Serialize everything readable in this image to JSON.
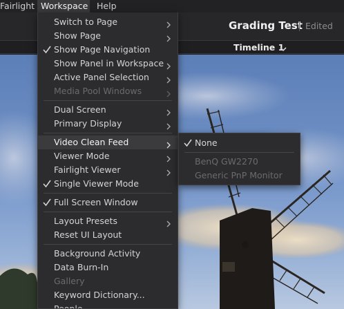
{
  "menubar": {
    "items": [
      {
        "label": "Fairlight"
      },
      {
        "label": "Workspace"
      },
      {
        "label": "Help"
      }
    ]
  },
  "header": {
    "project_title": "Grading Test",
    "project_status": "Edited"
  },
  "timeline": {
    "name": "Timeline 1"
  },
  "workspace_menu": {
    "items": [
      {
        "label": "Switch to Page",
        "submenu": true
      },
      {
        "label": "Show Page",
        "submenu": true
      },
      {
        "label": "Show Page Navigation",
        "checked": true
      },
      {
        "label": "Show Panel in Workspace",
        "submenu": true
      },
      {
        "label": "Active Panel Selection",
        "submenu": true
      },
      {
        "label": "Media Pool Windows",
        "submenu": true,
        "disabled": true
      },
      {
        "label": "Dual Screen",
        "submenu": true
      },
      {
        "label": "Primary Display",
        "submenu": true
      },
      {
        "label": "Video Clean Feed",
        "submenu": true,
        "highlighted": true
      },
      {
        "label": "Viewer Mode",
        "submenu": true
      },
      {
        "label": "Fairlight Viewer",
        "submenu": true
      },
      {
        "label": "Single Viewer Mode",
        "checked": true
      },
      {
        "label": "Full Screen Window",
        "checked": true
      },
      {
        "label": "Layout Presets",
        "submenu": true
      },
      {
        "label": "Reset UI Layout"
      },
      {
        "label": "Background Activity"
      },
      {
        "label": "Data Burn-In"
      },
      {
        "label": "Gallery",
        "disabled": true
      },
      {
        "label": "Keyword Dictionary..."
      },
      {
        "label": "People"
      }
    ]
  },
  "clean_feed_submenu": {
    "items": [
      {
        "label": "None",
        "checked": true
      },
      {
        "label": "BenQ GW2270",
        "disabled": true
      },
      {
        "label": "Generic PnP Monitor",
        "disabled": true
      }
    ]
  },
  "icons": {
    "check": "check-icon",
    "submenu_arrow": "chevron-right-icon",
    "timeline_dropdown": "chevron-down-icon"
  },
  "colors": {
    "menu_background": "#2c2c2e",
    "highlight": "#3b3b3e",
    "text": "#d4d4d4",
    "disabled_text": "#6b6b6e"
  }
}
